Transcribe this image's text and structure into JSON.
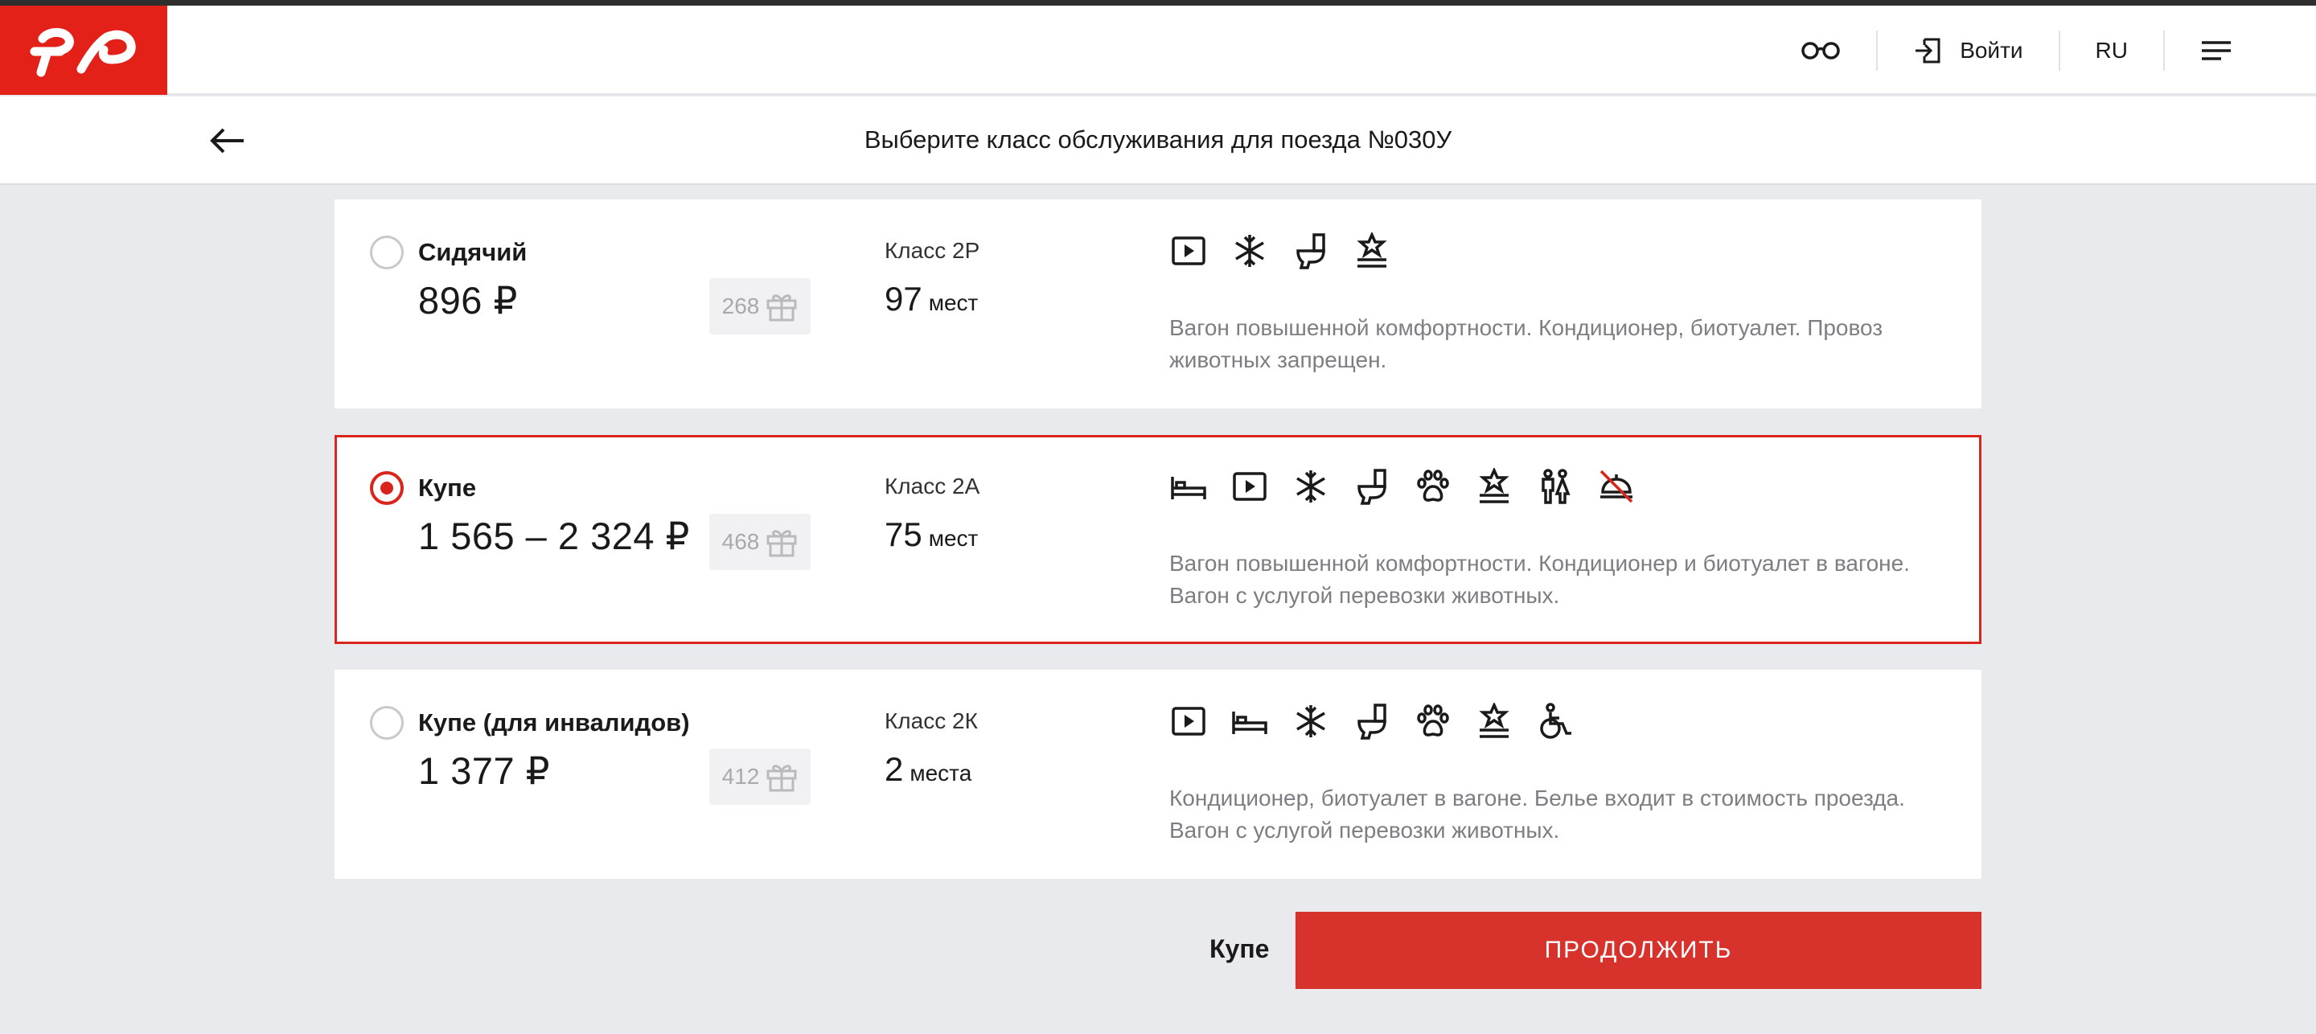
{
  "header": {
    "login_label": "Войти",
    "lang_label": "RU"
  },
  "subheader": {
    "title": "Выберите класс обслуживания для поезда №030У"
  },
  "options": [
    {
      "name": "Сидячий",
      "price": "896 ₽",
      "bonus": "268",
      "class": "Класс 2Р",
      "seats_count": "97",
      "seats_word": "мест",
      "selected": false,
      "icons": [
        "video-icon",
        "snowflake-icon",
        "toilet-icon",
        "comfort-icon"
      ],
      "description": "Вагон повышенной комфортности. Кондиционер, биотуалет. Провоз животных запрещен."
    },
    {
      "name": "Купе",
      "price": "1 565 – 2 324 ₽",
      "bonus": "468",
      "class": "Класс 2А",
      "seats_count": "75",
      "seats_word": "мест",
      "selected": true,
      "icons": [
        "bed-icon",
        "video-icon",
        "snowflake-icon",
        "toilet-icon",
        "paw-icon",
        "comfort-icon",
        "man-woman-icon",
        "no-food-icon"
      ],
      "description": "Вагон повышенной комфортности. Кондиционер и биотуалет в вагоне. Вагон с услугой перевозки животных."
    },
    {
      "name": "Купе (для инвалидов)",
      "price": "1 377 ₽",
      "bonus": "412",
      "class": "Класс 2К",
      "seats_count": "2",
      "seats_word": "места",
      "selected": false,
      "icons": [
        "video-icon",
        "bed-icon",
        "snowflake-icon",
        "toilet-icon",
        "paw-icon",
        "comfort-icon",
        "wheelchair-icon"
      ],
      "description": "Кондиционер, биотуалет в вагоне. Белье входит в стоимость проезда. Вагон с услугой перевозки животных."
    }
  ],
  "footer": {
    "selected_label": "Купе",
    "continue_label": "ПРОДОЛЖИТЬ"
  },
  "colors": {
    "brand": "#e32119",
    "accent": "#d7322b",
    "muted_text": "#7d7e83"
  }
}
